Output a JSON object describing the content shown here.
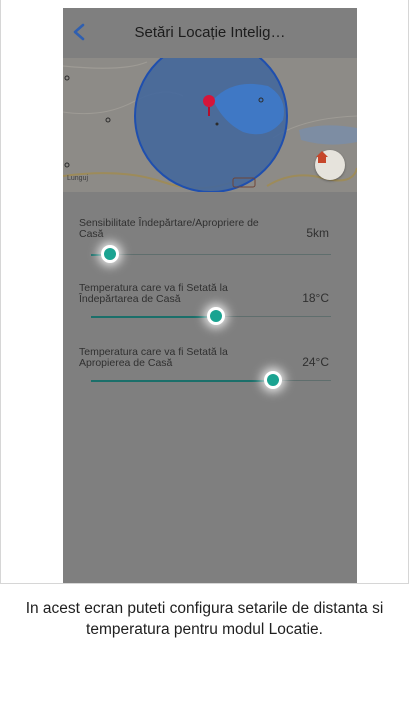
{
  "header": {
    "title": "Setări Locație Intelig…",
    "back_icon": "chevron-left-icon"
  },
  "map": {
    "label": "Lunguj",
    "home_icon": "home-icon",
    "home_icon_color": "#c6462a",
    "radius_color": "#1f4fae",
    "pin_color": "#d6153a"
  },
  "settings": [
    {
      "label": "Sensibilitate Îndepărtare/Apropriere de Casă",
      "value": "5km",
      "level": 0.08
    },
    {
      "label": "Temperatura care va fi Setată la Îndepărtarea de Casă",
      "value": "18°C",
      "level": 0.52
    },
    {
      "label": "Temperatura care va fi Setată la Apropierea de Casă",
      "value": "24°C",
      "level": 0.76
    }
  ],
  "accent_color": "#1aa391",
  "caption": "In acest ecran puteti configura setarile de distanta si temperatura pentru modul Locatie."
}
